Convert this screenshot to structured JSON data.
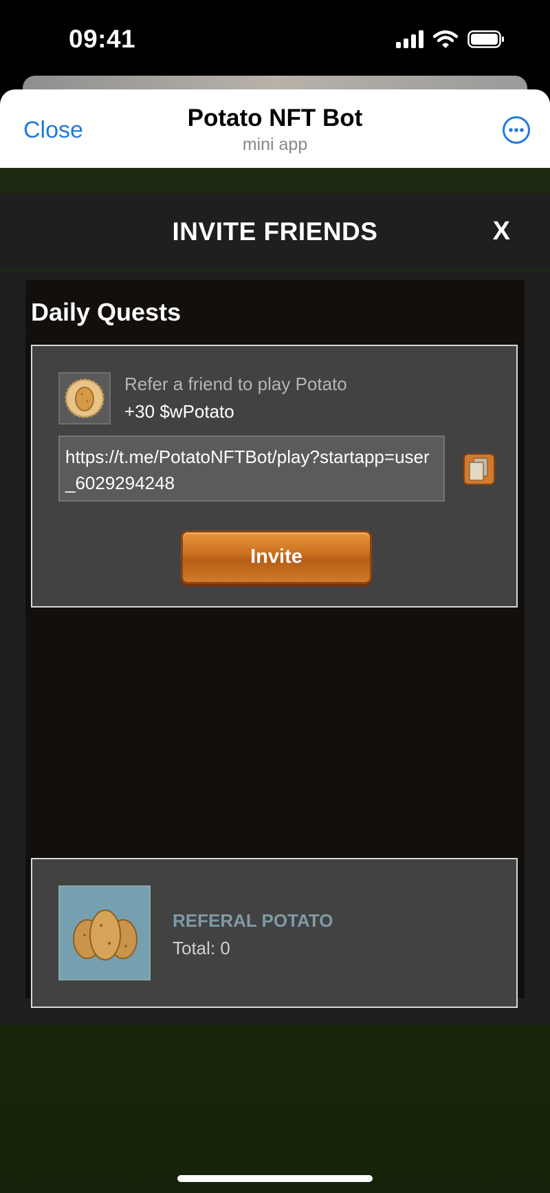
{
  "status_bar": {
    "time": "09:41"
  },
  "header": {
    "close_label": "Close",
    "title": "Potato NFT Bot",
    "subtitle": "mini app"
  },
  "modal": {
    "title": "INVITE FRIENDS",
    "close_label": "X"
  },
  "daily_quests": {
    "section_title": "Daily Quests",
    "quest": {
      "text": "Refer a friend to play Potato",
      "reward": "+30 $wPotato",
      "link": "https://t.me/PotatoNFTBot/play?startapp=user_6029294248",
      "invite_label": "Invite"
    }
  },
  "referral": {
    "title": "REFERAL POTATO",
    "total": "Total: 0"
  },
  "colors": {
    "accent": "#1f7ae0",
    "invite_button": "#c86e1e",
    "panel": "#424242",
    "background": "#120f0c"
  }
}
